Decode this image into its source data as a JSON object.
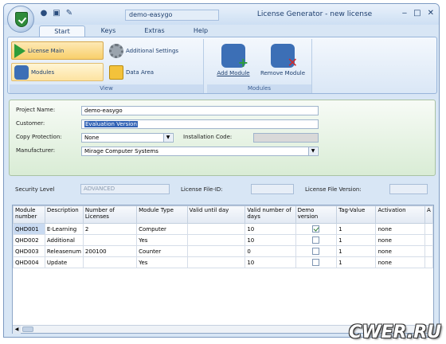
{
  "titlebar": {
    "document_tab": "demo-easygo",
    "window_title": "License Generator - new license",
    "min": "‒",
    "max": "□",
    "close": "✕"
  },
  "ribbon_tabs": [
    "Start",
    "Keys",
    "Extras",
    "Help"
  ],
  "ribbon": {
    "view_group": {
      "label": "View",
      "license_main": "License Main",
      "modules": "Modules",
      "additional_settings": "Additional Settings",
      "data_area": "Data Area"
    },
    "modules_group": {
      "label": "Modules",
      "add_module": "Add Module",
      "remove_module": "Remove Module"
    }
  },
  "form": {
    "project_name_label": "Project Name:",
    "project_name": "demo-easygo",
    "customer_label": "Customer:",
    "customer": "Evaluation Version",
    "copy_protection_label": "Copy Protection:",
    "copy_protection": "None",
    "installation_code_label": "Installation Code:",
    "installation_code": "",
    "manufacturer_label": "Manufacturer:",
    "manufacturer": "Mirage Computer Systems"
  },
  "security": {
    "level_label": "Security Level",
    "level_value": "ADVANCED",
    "file_id_label": "License File-ID:",
    "file_id": "",
    "file_version_label": "License File Version:",
    "file_version": ""
  },
  "table": {
    "headers": [
      "Module number",
      "Description",
      "Number of Licenses",
      "Module Type",
      "Valid until day",
      "Valid number of days",
      "Demo version",
      "Tag-Value",
      "Activation",
      "A"
    ],
    "rows": [
      {
        "module": "QHD001",
        "description": "E-Learning",
        "licenses": "2",
        "type": "Computer",
        "valid_until": "",
        "valid_days": "10",
        "demo": true,
        "tag": "1",
        "activation": "none"
      },
      {
        "module": "QHD002",
        "description": "Additional",
        "licenses": "",
        "type": "Yes",
        "valid_until": "",
        "valid_days": "10",
        "demo": false,
        "tag": "1",
        "activation": "none"
      },
      {
        "module": "QHD003",
        "description": "Releasenum",
        "licenses": "200100",
        "type": "Counter",
        "valid_until": "",
        "valid_days": "0",
        "demo": false,
        "tag": "1",
        "activation": "none"
      },
      {
        "module": "QHD004",
        "description": "Update",
        "licenses": "",
        "type": "Yes",
        "valid_until": "",
        "valid_days": "10",
        "demo": false,
        "tag": "1",
        "activation": "none"
      }
    ]
  },
  "watermark": "CWER.RU",
  "colors": {
    "accent": "#3162b5",
    "ribbon_bg": "#d8e6f5",
    "form_bg": "#d9ecd5"
  }
}
